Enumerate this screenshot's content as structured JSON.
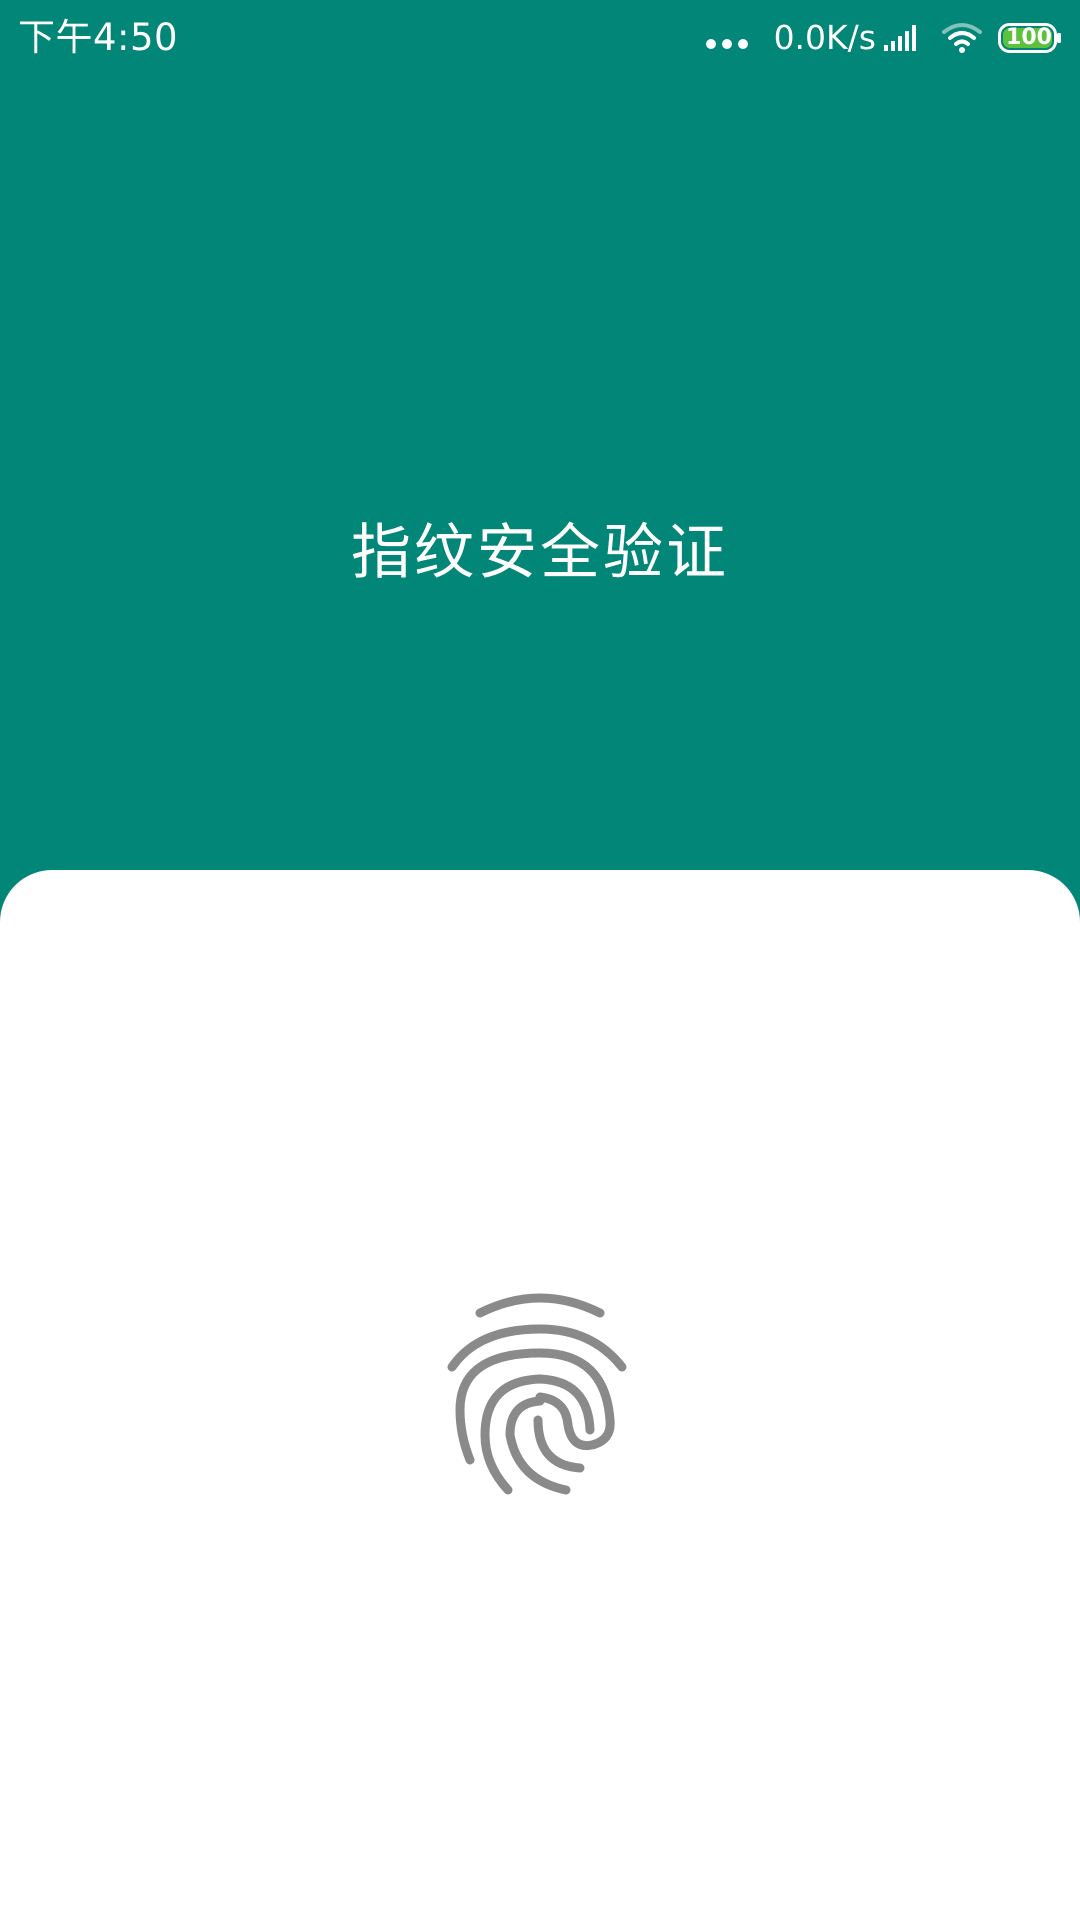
{
  "status_bar": {
    "time": "下午4:50",
    "network_speed": "0.0K/s",
    "battery_level": "100",
    "icons": [
      "more-dots-icon",
      "signal-icon",
      "wifi-icon",
      "battery-icon"
    ]
  },
  "main": {
    "title": "指纹安全验证"
  },
  "fingerprint": {
    "icon": "fingerprint-icon"
  },
  "colors": {
    "header_bg": "#028677",
    "sheet_bg": "#ffffff",
    "fingerprint": "#8a8a8a",
    "battery_fill": "#5cc23b"
  }
}
